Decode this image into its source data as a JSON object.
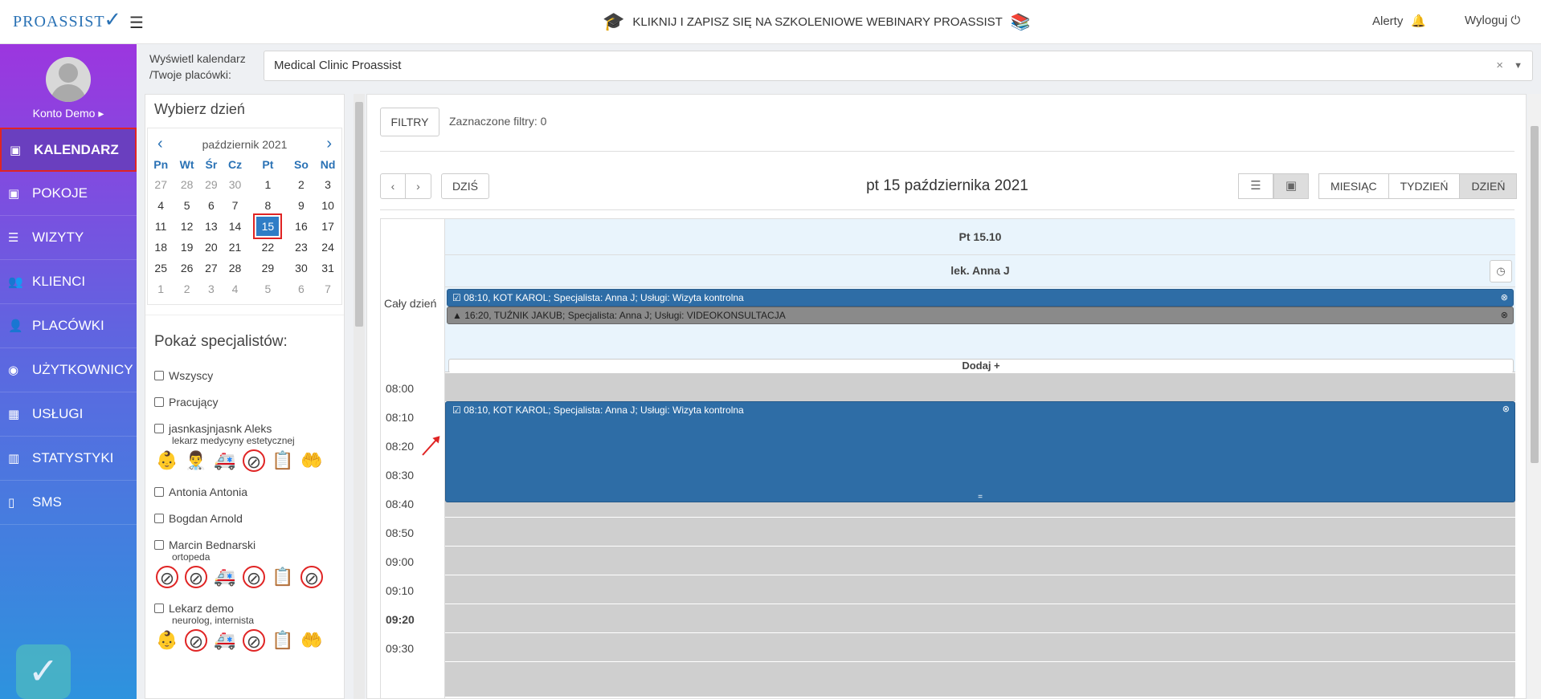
{
  "header": {
    "logo": "PROASSIST",
    "banner": "KLIKNIJ I ZAPISZ SIĘ NA SZKOLENIOWE WEBINARY PROASSIST",
    "alerts": "Alerty",
    "logout": "Wyloguj"
  },
  "sidebar": {
    "account": "Konto Demo",
    "items": [
      {
        "label": "KALENDARZ",
        "icon": "calendar-icon"
      },
      {
        "label": "POKOJE",
        "icon": "calendar-icon"
      },
      {
        "label": "WIZYTY",
        "icon": "list-icon"
      },
      {
        "label": "KLIENCI",
        "icon": "users-icon"
      },
      {
        "label": "PLACÓWKI",
        "icon": "user-plus-icon"
      },
      {
        "label": "UŻYTKOWNICY",
        "icon": "user-circle-icon"
      },
      {
        "label": "USŁUGI",
        "icon": "grid-icon"
      },
      {
        "label": "STATYSTYKI",
        "icon": "bar-chart-icon"
      },
      {
        "label": "SMS",
        "icon": "phone-icon"
      }
    ]
  },
  "filter": {
    "label1": "Wyświetl kalendarz",
    "label2": "/Twoje placówki:",
    "clinic": "Medical Clinic Proassist"
  },
  "left": {
    "choose_day": "Wybierz dzień",
    "month": "październik 2021",
    "weekdays": [
      "Pn",
      "Wt",
      "Śr",
      "Cz",
      "Pt",
      "So",
      "Nd"
    ],
    "weeks": [
      [
        "27",
        "28",
        "29",
        "30",
        "1",
        "2",
        "3"
      ],
      [
        "4",
        "5",
        "6",
        "7",
        "8",
        "9",
        "10"
      ],
      [
        "11",
        "12",
        "13",
        "14",
        "15",
        "16",
        "17"
      ],
      [
        "18",
        "19",
        "20",
        "21",
        "22",
        "23",
        "24"
      ],
      [
        "25",
        "26",
        "27",
        "28",
        "29",
        "30",
        "31"
      ],
      [
        "1",
        "2",
        "3",
        "4",
        "5",
        "6",
        "7"
      ]
    ],
    "show_specialists": "Pokaż specjalistów:",
    "specialists": [
      {
        "name": "Wszyscy"
      },
      {
        "name": "Pracujący"
      },
      {
        "name": "jasnkasjnjasnk Aleks",
        "sub": "lekarz medycyny estetycznej"
      },
      {
        "name": "Antonia Antonia"
      },
      {
        "name": "Bogdan Arnold"
      },
      {
        "name": "Marcin Bednarski",
        "sub": "ortopeda"
      },
      {
        "name": "Lekarz demo",
        "sub": "neurolog, internista"
      }
    ]
  },
  "main": {
    "filters_btn": "FILTRY",
    "filters_count": "Zaznaczone filtry: 0",
    "today": "DZIŚ",
    "date_title": "pt 15 października 2021",
    "views": [
      "MIESIĄC",
      "TYDZIEŃ",
      "DZIEŃ"
    ],
    "day_header": "Pt 15.10",
    "doctor": "lek. Anna J",
    "all_day": "Cały dzień",
    "events_allday": [
      "08:10, KOT KAROL; Specjalista: Anna J; Usługi: Wizyta kontrolna",
      "16:20, TUŹNIK JAKUB; Specjalista: Anna J; Usługi: VIDEOKONSULTACJA"
    ],
    "add": "Dodaj +",
    "times": [
      "08:00",
      "08:10",
      "08:20",
      "08:30",
      "08:40",
      "08:50",
      "09:00",
      "09:10",
      "09:20",
      "09:30"
    ],
    "event_block": "08:10, KOT KAROL; Specjalista: Anna J; Usługi: Wizyta kontrolna",
    "grip": "="
  }
}
